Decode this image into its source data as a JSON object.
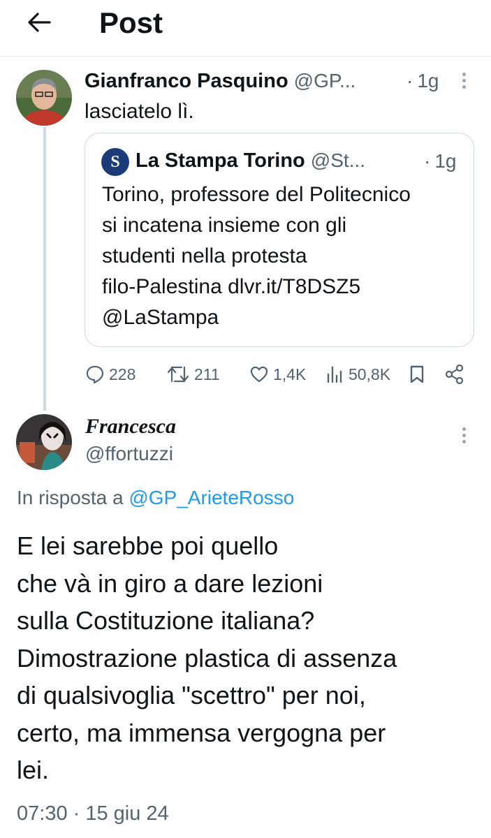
{
  "header": {
    "title": "Post",
    "back_icon": "arrow-left-icon"
  },
  "parent_tweet": {
    "author_name": "Gianfranco Pasquino",
    "handle": "@GP...",
    "separator": "·",
    "time": "1g",
    "text": "lasciatelo lì.",
    "quoted": {
      "logo_text": "S",
      "author_name": "La Stampa Torino",
      "handle": "@St...",
      "separator": "·",
      "time": "1g",
      "lines": [
        "Torino, professore del Politecnico",
        "si incatena insieme con gli",
        "studenti nella protesta",
        "filo-Palestina dlvr.it/T8DSZ5",
        "@LaStampa"
      ]
    },
    "actions": {
      "replies": "228",
      "reposts": "211",
      "likes": "1,4K",
      "views": "50,8K"
    }
  },
  "reply_tweet": {
    "author_name": "Francesca",
    "handle": "@ffortuzzi",
    "reply_prefix": "In risposta a",
    "reply_to": "@GP_ArieteRosso",
    "lines": [
      "E lei sarebbe poi quello",
      "che và in giro a dare lezioni",
      "sulla Costituzione italiana?",
      "Dimostrazione plastica di assenza",
      "di qualsivoglia \"scettro\" per noi,",
      "certo, ma immensa vergogna per",
      "lei."
    ],
    "timestamp": "07:30 · 15 giu 24"
  },
  "colors": {
    "accent": "#1d9bf0",
    "muted": "#536471",
    "border": "#cfd9de"
  }
}
